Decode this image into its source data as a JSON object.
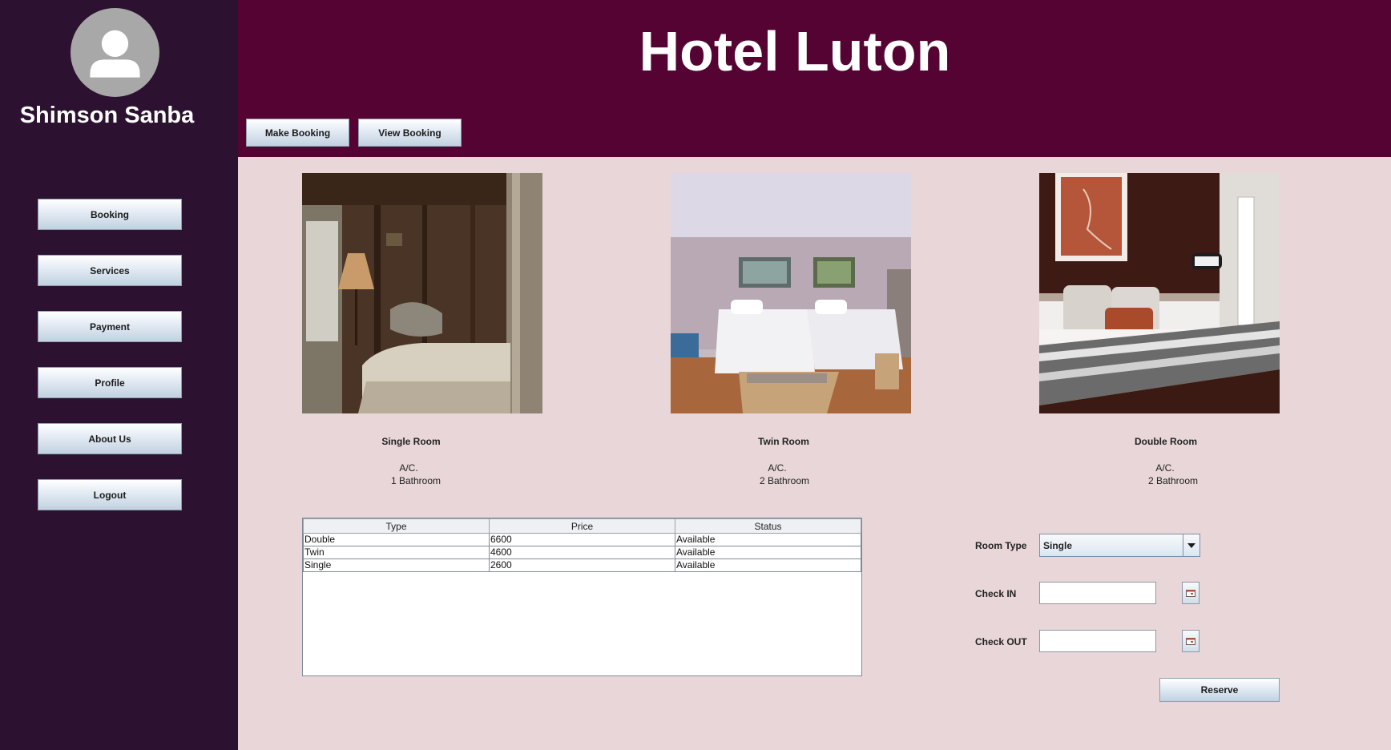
{
  "user": {
    "name": "Shimson Sanba",
    "avatar_icon": "user-silhouette-icon"
  },
  "sidebar": {
    "items": [
      {
        "label": "Booking"
      },
      {
        "label": "Services"
      },
      {
        "label": "Payment"
      },
      {
        "label": "Profile"
      },
      {
        "label": "About Us"
      },
      {
        "label": "Logout"
      }
    ]
  },
  "header": {
    "title": "Hotel Luton",
    "make_booking_label": "Make Booking",
    "view_booking_label": "View Booking"
  },
  "rooms": [
    {
      "name": "Single Room",
      "ac": "A/C.",
      "bathroom": "1 Bathroom"
    },
    {
      "name": "Twin Room",
      "ac": "A/C.",
      "bathroom": "2 Bathroom"
    },
    {
      "name": "Double Room",
      "ac": "A/C.",
      "bathroom": "2 Bathroom"
    }
  ],
  "table": {
    "headers": [
      "Type",
      "Price",
      "Status"
    ],
    "rows": [
      [
        "Double",
        "6600",
        "Available"
      ],
      [
        "Twin",
        "4600",
        "Available"
      ],
      [
        "Single",
        "2600",
        "Available"
      ]
    ]
  },
  "form": {
    "room_type_label": "Room Type",
    "room_type_value": "Single",
    "check_in_label": "Check IN",
    "check_in_value": "",
    "check_out_label": "Check OUT",
    "check_out_value": "",
    "reserve_label": "Reserve"
  },
  "colors": {
    "sidebar": "#2c1130",
    "header": "#540333",
    "content": "#e8d6d8"
  }
}
